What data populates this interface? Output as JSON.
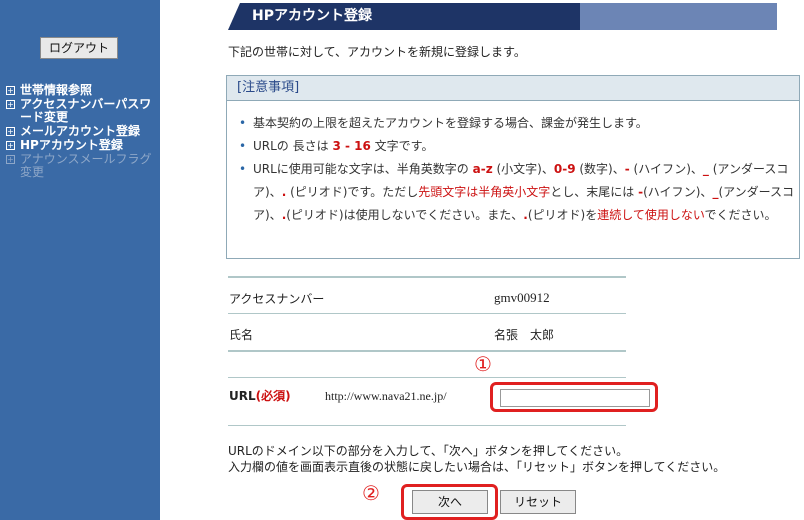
{
  "sidebar": {
    "logout_label": "ログアウト",
    "items": [
      {
        "label": "世帯情報参照",
        "enabled": true
      },
      {
        "label": "アクセスナンバーパスワード変更",
        "enabled": true
      },
      {
        "label": "メールアカウント登録",
        "enabled": true
      },
      {
        "label": "HPアカウント登録",
        "enabled": true
      },
      {
        "label": "アナウンスメールフラグ変更",
        "enabled": false
      }
    ],
    "item_icon": "plus-box-icon"
  },
  "header": {
    "title": "HPアカウント登録"
  },
  "intro": "下記の世帯に対して、アカウントを新規に登録します。",
  "notice": {
    "title": "[注意事項]",
    "bullet1": "基本契約の上限を超えたアカウントを登録する場合、課金が発生します。",
    "b2_pre": "URLの 長さは ",
    "b2_range": "3 - 16",
    "b2_post": " 文字です。",
    "b3_a": "URLに使用可能な文字は、半角英数字の ",
    "b3_az": "a-z",
    "b3_az_note": " (小文字)、",
    "b3_09": "0-9",
    "b3_09_note": " (数字)、",
    "b3_hyphen": "-",
    "b3_hyphen_note": " (ハイフン)、",
    "b3_us": "_",
    "b3_us_note": " (アンダースコア)、",
    "b3_dot": ".",
    "b3_dot_note": " (ピリオド)です。ただし",
    "b3_first": "先頭文字は半角英小文字",
    "b3_mid": "とし、末尾には ",
    "b3_hyphen2": "-",
    "b3_mid2": "(ハイフン)、",
    "b3_us2": "_",
    "b3_mid3": "(アンダースコア)、",
    "b3_dot2": ".",
    "b3_mid4": "(ピリオド)は使用しないでください。また、",
    "b3_dot3": ".",
    "b3_mid5": "(ピリオド)を",
    "b3_consec": "連続して使用しない",
    "b3_end": "でください。"
  },
  "info": {
    "access_label": "アクセスナンバー",
    "access_value": "gmv00912",
    "name_label": "氏名",
    "name_value": "名張　太郎"
  },
  "url": {
    "label": "URL",
    "required": "(必須)",
    "prefix": "http://www.nava21.ne.jp/",
    "value": ""
  },
  "annotations": {
    "one": "①",
    "two": "②"
  },
  "help": {
    "line1": "URLのドメイン以下の部分を入力して、「次へ」ボタンを押してください。",
    "line2": "入力欄の値を画面表示直後の状態に戻したい場合は、「リセット」ボタンを押してください。"
  },
  "buttons": {
    "next": "次へ",
    "reset": "リセット"
  },
  "colors": {
    "sidebar": "#3a6aa6",
    "header_dark": "#1e3466",
    "header_light": "#6c85b5",
    "accent_red": "#cc1111",
    "annotation_red": "#e02020"
  }
}
